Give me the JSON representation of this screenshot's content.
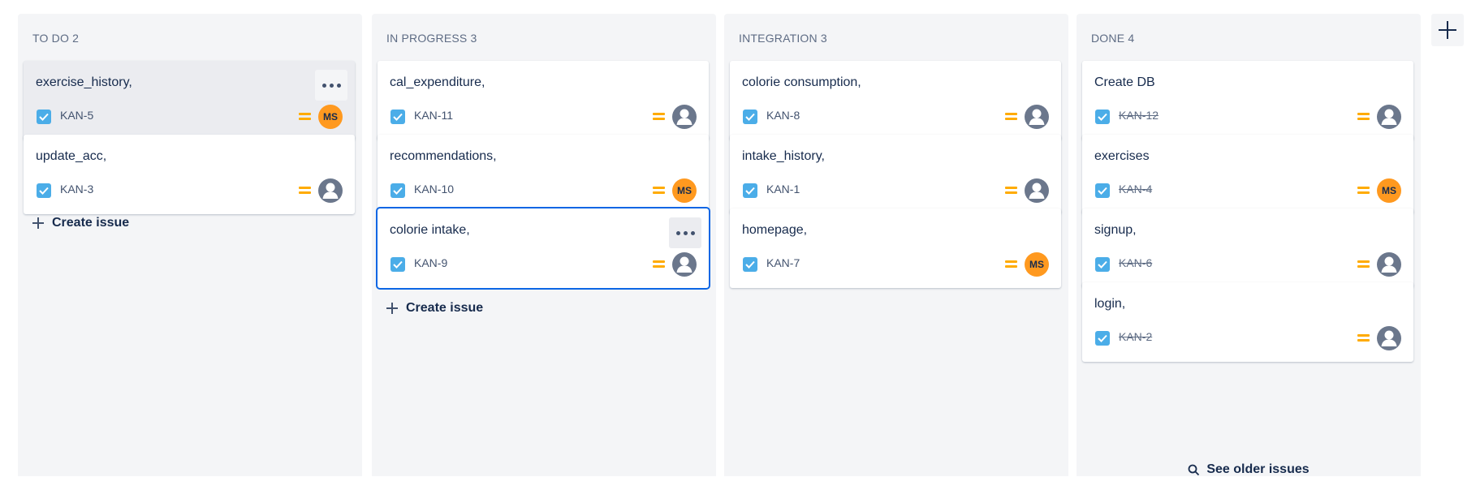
{
  "board": {
    "columns": [
      {
        "header": "TO DO 2",
        "cards": [
          {
            "title": "exercise_history,",
            "key": "KAN-5",
            "assignee": "MS",
            "state": "hovered",
            "done": false
          },
          {
            "title": "update_acc,",
            "key": "KAN-3",
            "assignee": "",
            "state": "normal",
            "done": false
          }
        ],
        "create_label": "Create issue"
      },
      {
        "header": "IN PROGRESS 3",
        "cards": [
          {
            "title": "cal_expenditure,",
            "key": "KAN-11",
            "assignee": "",
            "state": "normal",
            "done": false
          },
          {
            "title": "recommendations,",
            "key": "KAN-10",
            "assignee": "MS",
            "state": "normal",
            "done": false
          },
          {
            "title": "colorie intake,",
            "key": "KAN-9",
            "assignee": "",
            "state": "selected",
            "done": false
          }
        ],
        "create_label": "Create issue"
      },
      {
        "header": "INTEGRATION 3",
        "cards": [
          {
            "title": "colorie consumption,",
            "key": "KAN-8",
            "assignee": "",
            "state": "normal",
            "done": false
          },
          {
            "title": "intake_history,",
            "key": "KAN-1",
            "assignee": "",
            "state": "normal",
            "done": false
          },
          {
            "title": "homepage,",
            "key": "KAN-7",
            "assignee": "MS",
            "state": "normal",
            "done": false
          }
        ]
      },
      {
        "header": "DONE 4",
        "cards": [
          {
            "title": "Create DB",
            "key": "KAN-12",
            "assignee": "",
            "state": "normal",
            "done": true
          },
          {
            "title": "exercises",
            "key": "KAN-4",
            "assignee": "MS",
            "state": "normal",
            "done": true
          },
          {
            "title": "signup,",
            "key": "KAN-6",
            "assignee": "",
            "state": "normal",
            "done": true
          },
          {
            "title": "login,",
            "key": "KAN-2",
            "assignee": "",
            "state": "normal",
            "done": true
          }
        ],
        "see_older_label": "See older issues"
      }
    ]
  },
  "icons": {
    "issue_type": "task-checkbox-icon",
    "priority": "medium-priority-icon",
    "unassigned": "default-avatar-icon",
    "more": "more-actions-icon",
    "add": "plus-icon",
    "search": "search-icon"
  },
  "colors": {
    "column_bg": "#f4f5f7",
    "task_blue": "#4bade8",
    "priority_medium": "#ffab00",
    "avatar_orange": "#ff991f",
    "selected_border": "#0c66e4"
  }
}
